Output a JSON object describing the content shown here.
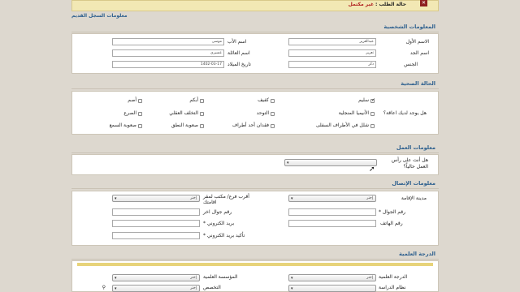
{
  "status": {
    "label": "حالة الطلب :",
    "value": "غير مكتمل",
    "close_icon": "close-icon"
  },
  "old_record_link": "معلومات السجل القديم",
  "personal": {
    "title": "المعلومات الشخصية",
    "first_name_label": "الاسم الأول",
    "first_name_value": "عبدالعزيز",
    "father_name_label": "اسم الأب",
    "father_name_value": "موسى",
    "grandfather_label": "اسم الجد",
    "grandfather_value": "تعزيز",
    "family_label": "اسم العائلة",
    "family_value": "عسيري",
    "gender_label": "الجنس",
    "gender_value": "ذكر",
    "birth_label": "تاريخ الميلاد",
    "birth_value": "1402-03-17"
  },
  "health": {
    "title": "الحالة الصحية",
    "question": "هل يوجد لديك اعاقة؟",
    "options": {
      "healthy": "سليم",
      "blind": "كفيف",
      "mute": "أبكم",
      "deaf": "أصم",
      "bones": "الأنيميا المنجلية",
      "autism": "التوحد",
      "mental": "التخلف العقلي",
      "epilepsy": "الصرع",
      "lower_limbs": "شلل في الأطراف السفلى",
      "limb_loss": "فقدان أحد أطراف",
      "speech": "صعوبة النطق",
      "hearing": "صعوبة السمع"
    }
  },
  "work": {
    "title": "معلومات العمل",
    "question_line1": "هل أنت على رأس",
    "question_line2": "العمل حالياً؟"
  },
  "contact": {
    "title": "معلومات الإتصال",
    "city_label": "مدينة الإقامة",
    "city_value": "إختر",
    "branch_label_line1": "أقرب فرع/ مكتب لمقر",
    "branch_label_line2": "اقامتك",
    "branch_value": "إختر",
    "mobile_label": "رقم الجوال *",
    "other_mobile_label": "رقم جوال اخر",
    "phone_label": "رقم الهاتف",
    "email_label": "بريد الكتروني *",
    "email_confirm_label": "تأكيد بريد الكتروني *"
  },
  "education": {
    "title": "الدرجة العلمية",
    "degree_label": "الدرجة العلمية",
    "degree_value": "إختر",
    "institution_label": "المؤسسة العلمية",
    "institution_value": "إختر",
    "study_system_label": "نظام الدراسة",
    "major_label": "التخصص",
    "major_value": "إختر"
  }
}
